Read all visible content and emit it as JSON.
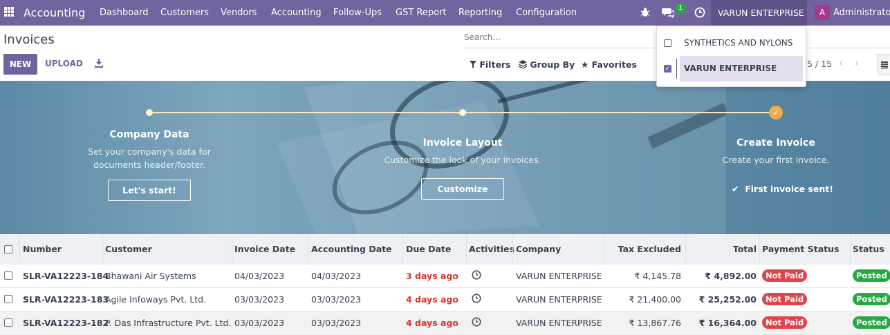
{
  "navbar": {
    "app_title": "Accounting",
    "menu": [
      "Dashboard",
      "Customers",
      "Vendors",
      "Accounting",
      "Follow-Ups",
      "GST Report",
      "Reporting",
      "Configuration"
    ],
    "message_count": "1",
    "company": "VARUN ENTERPRISE",
    "avatar_letter": "A",
    "user": "Administrator"
  },
  "control": {
    "title": "Invoices",
    "new_label": "NEW",
    "upload_label": "UPLOAD",
    "search_placeholder": "Search...",
    "filters_label": "Filters",
    "groupby_label": "Group By",
    "favorites_label": "Favorites",
    "pager": "5 / 15"
  },
  "company_dropdown": {
    "items": [
      {
        "label": "SYNTHETICS AND NYLONS",
        "checked": false
      },
      {
        "label": "VARUN ENTERPRISE",
        "checked": true
      }
    ]
  },
  "onboarding": {
    "steps": [
      {
        "title": "Company Data",
        "desc": "Set your company's data for documents header/footer.",
        "button": "Let's start!"
      },
      {
        "title": "Invoice Layout",
        "desc": "Customize the look of your invoices.",
        "button": "Customize"
      },
      {
        "title": "Create Invoice",
        "desc": "Create your first invoice.",
        "done_text": "First invoice sent!"
      }
    ]
  },
  "table": {
    "headers": [
      "Number",
      "Customer",
      "Invoice Date",
      "Accounting Date",
      "Due Date",
      "Activities",
      "Company",
      "Tax Excluded",
      "Total",
      "Payment Status",
      "Status"
    ],
    "rows": [
      {
        "number": "SLR-VA12223-184",
        "customer": "Bhawani Air Systems",
        "invoice_date": "04/03/2023",
        "accounting_date": "04/03/2023",
        "due": "3 days ago",
        "company": "VARUN ENTERPRISE",
        "tax_excluded": "₹ 4,145.78",
        "total": "₹ 4,892.00",
        "payment_status": "Not Paid",
        "status": "Posted"
      },
      {
        "number": "SLR-VA12223-183",
        "customer": "Agile Infoways Pvt. Ltd.",
        "invoice_date": "03/03/2023",
        "accounting_date": "03/03/2023",
        "due": "4 days ago",
        "company": "VARUN ENTERPRISE",
        "tax_excluded": "₹ 21,400.00",
        "total": "₹ 25,252.00",
        "payment_status": "Not Paid",
        "status": "Posted"
      },
      {
        "number": "SLR-VA12223-182",
        "customer": "P. Das Infrastructure Pvt. Ltd.",
        "invoice_date": "03/03/2023",
        "accounting_date": "03/03/2023",
        "due": "4 days ago",
        "company": "VARUN ENTERPRISE",
        "tax_excluded": "₹ 13,867.76",
        "total": "₹ 16,364.00",
        "payment_status": "Not Paid",
        "status": "Posted"
      }
    ]
  },
  "colors": {
    "brand": "#71639e",
    "overdue": "#d9342b",
    "not_paid": "#e2434b",
    "posted": "#28a745",
    "step_done": "#f0ad4e"
  },
  "icons": [
    "apps-grid-icon",
    "bug-icon",
    "chat-icon",
    "clock-icon",
    "download-icon",
    "filter-icon",
    "layers-icon",
    "star-icon",
    "chevron-left-icon",
    "chevron-right-icon",
    "list-view-icon",
    "check-icon",
    "activity-clock-icon"
  ]
}
